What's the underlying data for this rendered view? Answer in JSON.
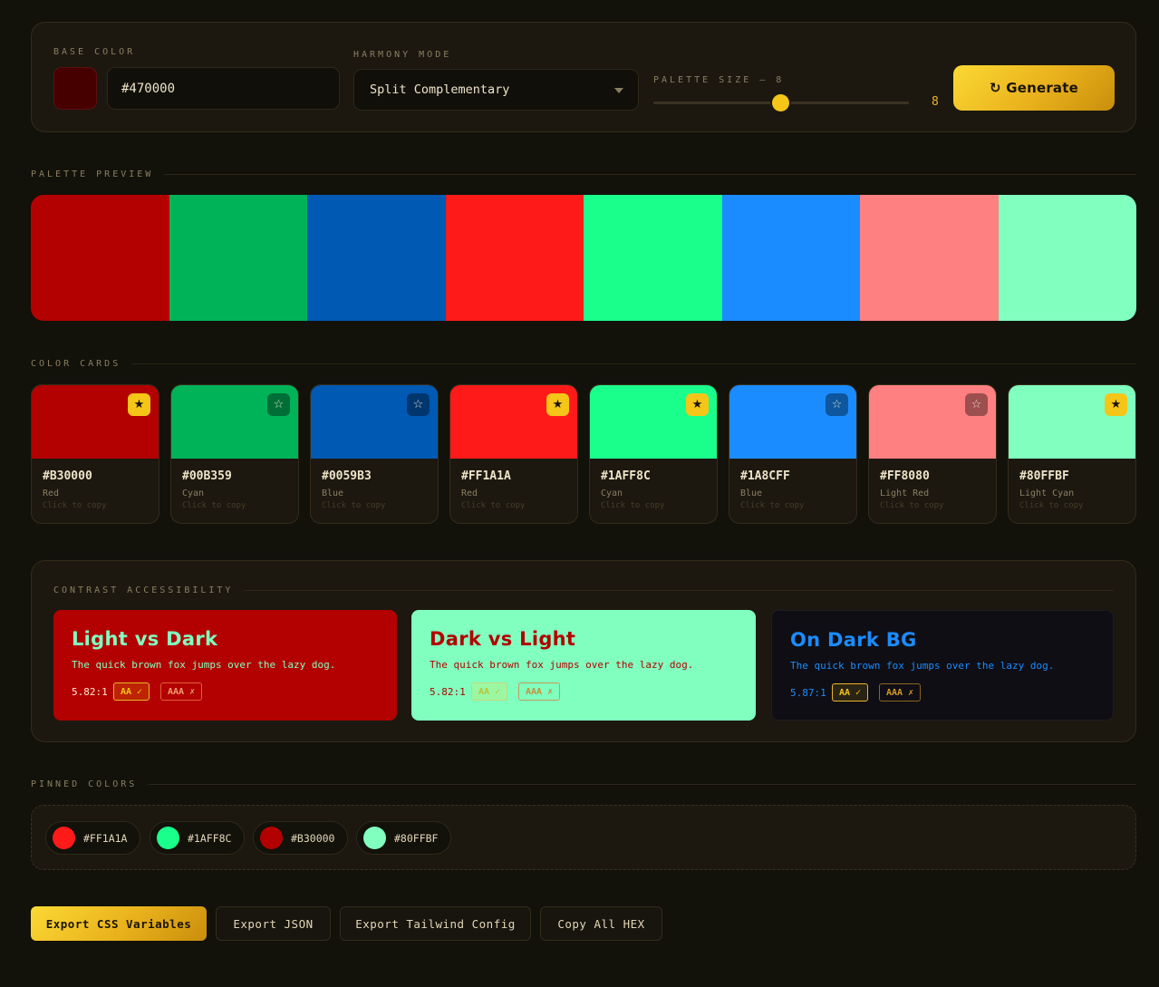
{
  "controls": {
    "base_color_label": "BASE COLOR",
    "base_color_value": "#470000",
    "base_color_swatch": "#470000",
    "harmony_label": "HARMONY MODE",
    "harmony_value": "Split Complementary",
    "palette_size_label": "PALETTE SIZE — 8",
    "palette_size_value": "8",
    "palette_size_slider_fraction": 0.5,
    "generate_label": "↻ Generate"
  },
  "sections": {
    "preview": "PALETTE PREVIEW",
    "cards": "COLOR CARDS",
    "contrast": "CONTRAST ACCESSIBILITY",
    "pinned": "PINNED COLORS"
  },
  "palette": [
    {
      "hex": "#B30000",
      "name": "Red",
      "pinned": true,
      "copy": "Click to copy"
    },
    {
      "hex": "#00B359",
      "name": "Cyan",
      "pinned": false,
      "copy": "Click to copy"
    },
    {
      "hex": "#0059B3",
      "name": "Blue",
      "pinned": false,
      "copy": "Click to copy"
    },
    {
      "hex": "#FF1A1A",
      "name": "Red",
      "pinned": true,
      "copy": "Click to copy"
    },
    {
      "hex": "#1AFF8C",
      "name": "Cyan",
      "pinned": true,
      "copy": "Click to copy"
    },
    {
      "hex": "#1A8CFF",
      "name": "Blue",
      "pinned": false,
      "copy": "Click to copy"
    },
    {
      "hex": "#FF8080",
      "name": "Light Red",
      "pinned": false,
      "copy": "Click to copy"
    },
    {
      "hex": "#80FFBF",
      "name": "Light Cyan",
      "pinned": true,
      "copy": "Click to copy"
    }
  ],
  "pin_icons": {
    "pinned": "★",
    "unpinned": "☆"
  },
  "contrast": [
    {
      "title": "Light vs Dark",
      "sample": "The quick brown fox jumps over the lazy dog.",
      "ratio": "5.82:1",
      "aa": "AA ✓",
      "aaa": "AAA ✗",
      "bg": "#B30000",
      "fg": "#80FFBF"
    },
    {
      "title": "Dark vs Light",
      "sample": "The quick brown fox jumps over the lazy dog.",
      "ratio": "5.82:1",
      "aa": "AA ✓",
      "aaa": "AAA ✗",
      "bg": "#80FFBF",
      "fg": "#B30000"
    },
    {
      "title": "On Dark BG",
      "sample": "The quick brown fox jumps over the lazy dog.",
      "ratio": "5.87:1",
      "aa": "AA ✓",
      "aaa": "AAA ✗",
      "bg": "#0f0e14",
      "fg": "#1A8CFF"
    }
  ],
  "pinned": [
    "#FF1A1A",
    "#1AFF8C",
    "#B30000",
    "#80FFBF"
  ],
  "export": {
    "css": "Export CSS Variables",
    "json": "Export JSON",
    "tailwind": "Export Tailwind Config",
    "hex": "Copy All HEX"
  },
  "colors": {
    "accent": "#F5C518",
    "background": "#12110A",
    "panel": "#1C1810"
  }
}
